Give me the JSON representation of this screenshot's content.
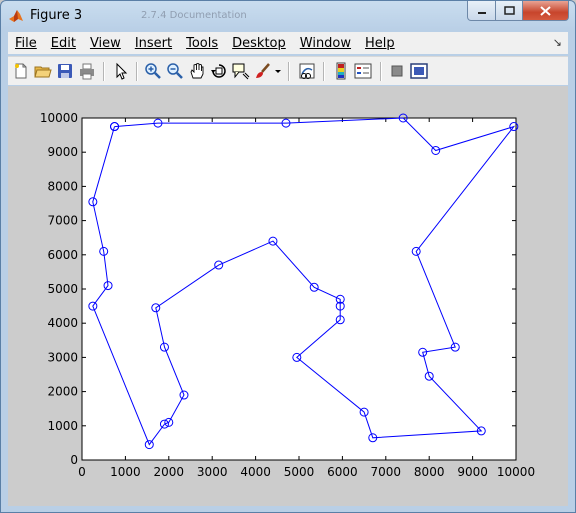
{
  "window": {
    "title": "Figure 3",
    "background_tabs": [
      "2.7.4 Documentation"
    ]
  },
  "menu": {
    "items": [
      "File",
      "Edit",
      "View",
      "Insert",
      "Tools",
      "Desktop",
      "Window",
      "Help"
    ]
  },
  "toolbar": {
    "buttons": [
      "new-figure",
      "open-file",
      "save-figure",
      "print-figure",
      "edit-plot",
      "zoom-in",
      "zoom-out",
      "pan",
      "rotate-3d",
      "data-cursor",
      "brush",
      "link-plot",
      "insert-colorbar",
      "insert-legend",
      "hide-plot-tools",
      "show-plot-tools"
    ]
  },
  "chart_data": {
    "type": "line",
    "title": "",
    "xlabel": "",
    "ylabel": "",
    "xlim": [
      0,
      10000
    ],
    "ylim": [
      0,
      10000
    ],
    "xticks": [
      "0",
      "1000",
      "2000",
      "3000",
      "4000",
      "5000",
      "6000",
      "7000",
      "8000",
      "9000",
      "10000"
    ],
    "yticks": [
      "0",
      "1000",
      "2000",
      "3000",
      "4000",
      "5000",
      "6000",
      "7000",
      "8000",
      "9000",
      "10000"
    ],
    "grid": false,
    "marker": "circle",
    "line_color": "#0000ff",
    "series": [
      {
        "x": [
          750,
          1750,
          4700,
          7400,
          8150,
          9950,
          7700,
          8600,
          7850,
          8000,
          9200,
          6700,
          6500,
          4950,
          5950,
          5950,
          5950,
          5350,
          4400,
          3150,
          1700,
          1900,
          2350,
          2000,
          1900,
          1550,
          250,
          600,
          500,
          250,
          750
        ],
        "y": [
          9750,
          9850,
          9850,
          10000,
          9050,
          9750,
          6100,
          3300,
          3150,
          2450,
          850,
          650,
          1400,
          3000,
          4100,
          4500,
          4700,
          5050,
          6400,
          5700,
          4450,
          3300,
          1900,
          1100,
          1050,
          450,
          4500,
          5100,
          6100,
          7550,
          9750
        ]
      }
    ]
  }
}
